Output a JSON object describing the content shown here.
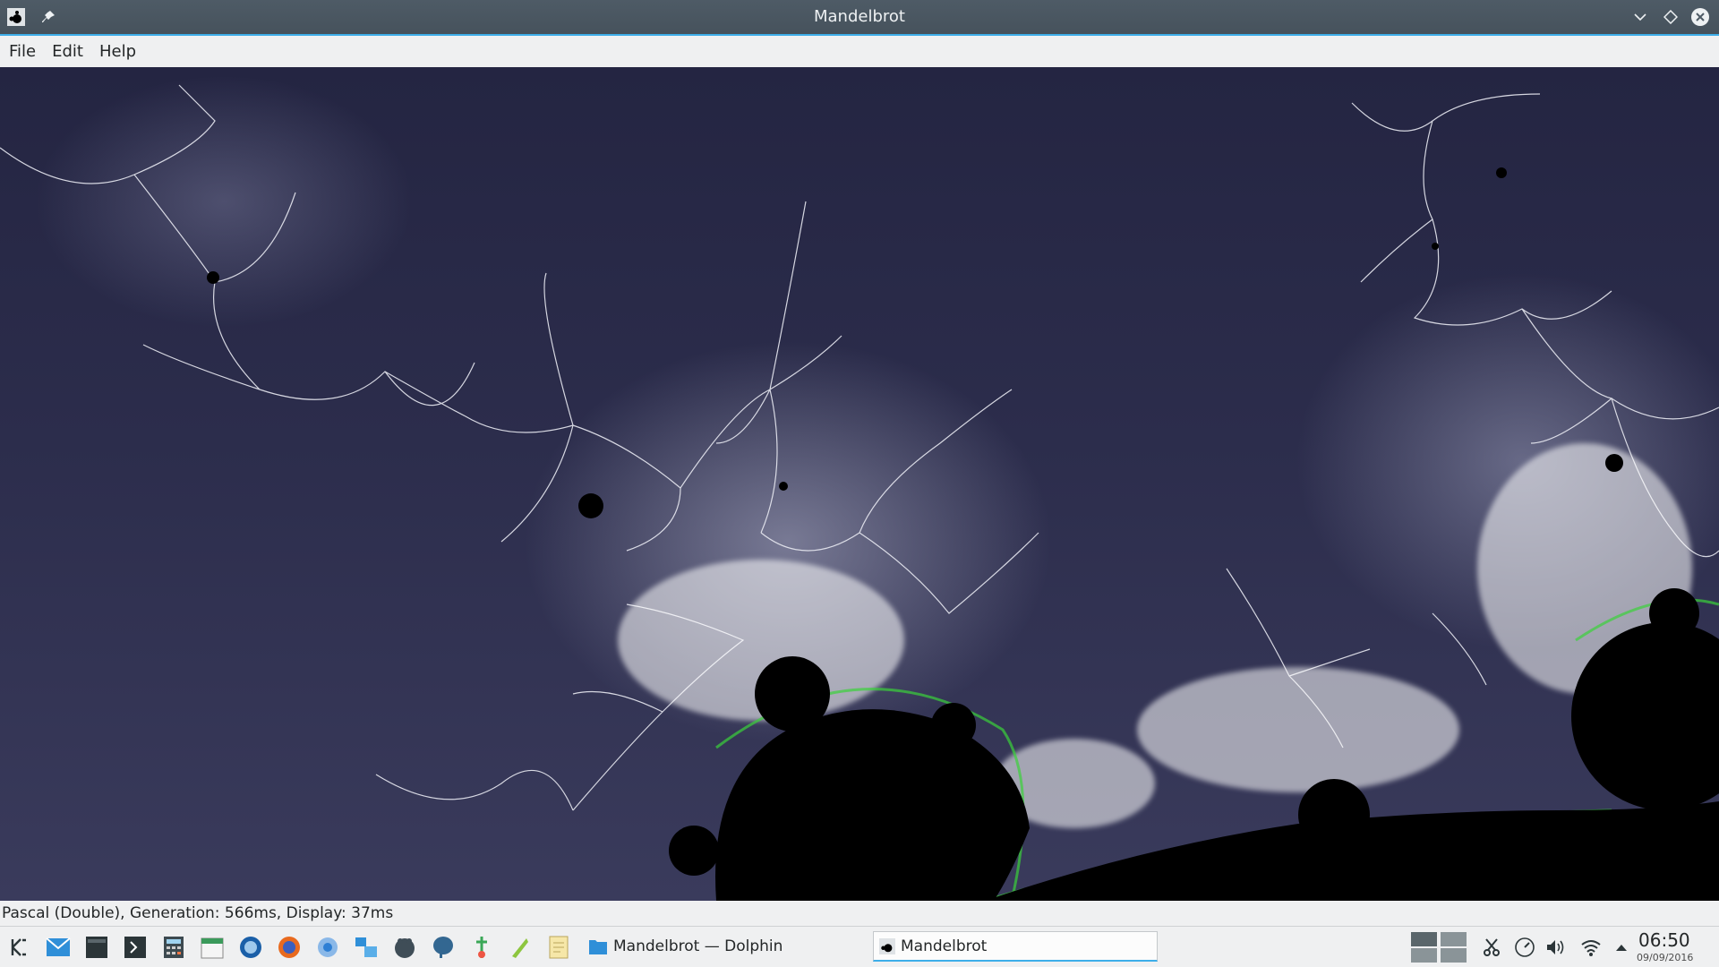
{
  "window": {
    "title": "Mandelbrot",
    "app_icon": "mandelbrot-app-icon",
    "buttons": [
      "pin-icon",
      "minimize-chevron-icon",
      "maximize-diamond-icon",
      "close-icon"
    ]
  },
  "menu": {
    "file": "File",
    "edit": "Edit",
    "help": "Help"
  },
  "status": {
    "text": "Pascal (Double), Generation: 566ms, Display: 37ms"
  },
  "taskbar": {
    "launchers": [
      "kde-menu-icon",
      "mail-icon",
      "terminal-icon",
      "konsole-icon",
      "calculator-icon",
      "calendar-icon",
      "thunderbird-icon",
      "firefox-icon",
      "chromium-icon",
      "network-manager-icon",
      "gimp-icon",
      "postgresql-icon",
      "git-icon",
      "inkscape-icon",
      "notes-icon"
    ],
    "tasks": [
      {
        "label": "Mandelbrot — Dolphin",
        "icon": "dolphin-folder-icon",
        "active": false
      },
      {
        "label": "Mandelbrot",
        "icon": "mandelbrot-app-icon",
        "active": true
      }
    ],
    "tray": [
      "pager-icon",
      "scissors-icon",
      "clock-dial-icon",
      "volume-icon",
      "wifi-icon",
      "expand-up-icon"
    ],
    "clock": {
      "time": "06:50",
      "date": "09/09/2016"
    }
  },
  "colors": {
    "accent": "#3daee9",
    "titlebar": "#4e5b66",
    "panel": "#eff0f1",
    "fractal_bg": "#2a2b4a"
  }
}
